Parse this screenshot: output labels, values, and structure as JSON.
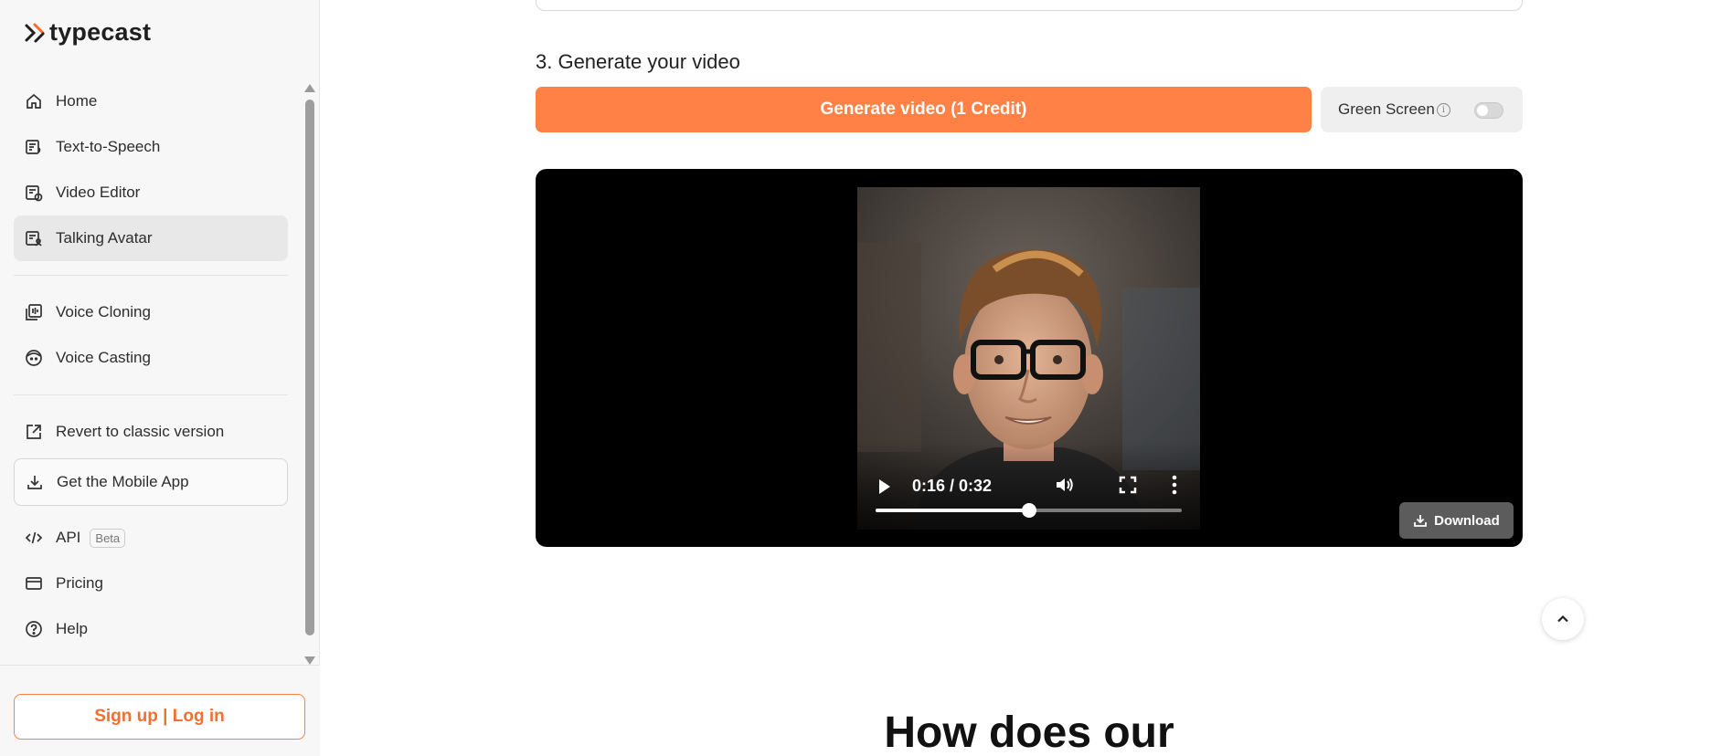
{
  "brand": {
    "name": "typecast"
  },
  "sidebar": {
    "nav_primary": [
      {
        "label": "Home",
        "icon": "home-icon",
        "active": false
      },
      {
        "label": "Text-to-Speech",
        "icon": "text-to-speech-icon",
        "active": false
      },
      {
        "label": "Video Editor",
        "icon": "video-editor-icon",
        "active": false
      },
      {
        "label": "Talking Avatar",
        "icon": "talking-avatar-icon",
        "active": true
      }
    ],
    "nav_voice": [
      {
        "label": "Voice Cloning",
        "icon": "voice-cloning-icon"
      },
      {
        "label": "Voice Casting",
        "icon": "voice-casting-icon"
      }
    ],
    "revert": {
      "label": "Revert to classic version",
      "icon": "external-link-icon"
    },
    "mobile_app": {
      "label": "Get the Mobile App",
      "icon": "download-icon"
    },
    "api": {
      "label": "API",
      "badge": "Beta",
      "icon": "code-icon"
    },
    "pricing": {
      "label": "Pricing",
      "icon": "credit-card-icon"
    },
    "help": {
      "label": "Help",
      "icon": "help-circle-icon"
    },
    "login": {
      "label": "Sign up | Log in"
    }
  },
  "main": {
    "section_title": "3. Generate your video",
    "generate_button": "Generate video (1 Credit)",
    "green_screen": {
      "label": "Green Screen",
      "enabled": false
    },
    "video": {
      "time_display": "0:16 / 0:32",
      "progress_fraction": 0.5
    },
    "download_button": "Download",
    "how_heading": "How does our"
  },
  "colors": {
    "accent": "#ff8146",
    "accent_text": "#f07030",
    "sidebar_bg": "#f7f7f7",
    "active_item_bg": "#e8e8e8"
  }
}
